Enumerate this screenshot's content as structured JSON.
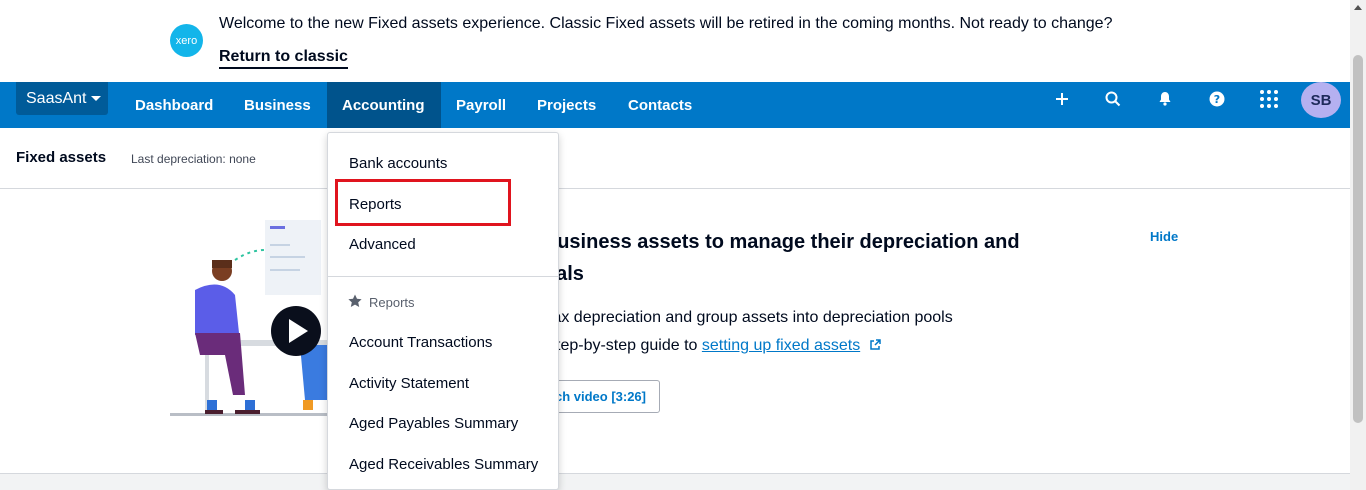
{
  "banner": {
    "logo_text": "xero",
    "message": "Welcome to the new Fixed assets experience. Classic Fixed assets will be retired in the coming months. Not ready to change?",
    "link": "Return to classic"
  },
  "nav": {
    "org": "SaasAnt",
    "items": [
      "Dashboard",
      "Business",
      "Accounting",
      "Payroll",
      "Projects",
      "Contacts"
    ],
    "active": "Accounting",
    "icons": [
      "plus-icon",
      "search-icon",
      "bell-icon",
      "help-icon",
      "apps-grid-icon"
    ],
    "avatar_initials": "SB"
  },
  "page": {
    "title": "Fixed assets",
    "last_depreciation": "Last depreciation: none"
  },
  "card": {
    "heading": "business assets to manage their depreciation and sals",
    "heading_line1": "business assets to manage their depreciation and",
    "heading_line2": "sals",
    "hide": "Hide",
    "line1": "tax depreciation and group assets into depreciation pools",
    "line2_prefix": "step-by-step guide to ",
    "line2_link": "setting up fixed assets",
    "video_button": "ch video [3:26]"
  },
  "dropdown": {
    "top_items": [
      "Bank accounts",
      "Reports",
      "Advanced"
    ],
    "section_label": "Reports",
    "report_items": [
      "Account Transactions",
      "Activity Statement",
      "Aged Payables Summary",
      "Aged Receivables Summary"
    ],
    "highlighted": "Reports"
  },
  "colors": {
    "nav_bg": "#0078c8",
    "nav_active": "#00538c",
    "link": "#0078c8",
    "highlight_border": "#e0141e",
    "avatar_bg": "#b5b0f0"
  }
}
